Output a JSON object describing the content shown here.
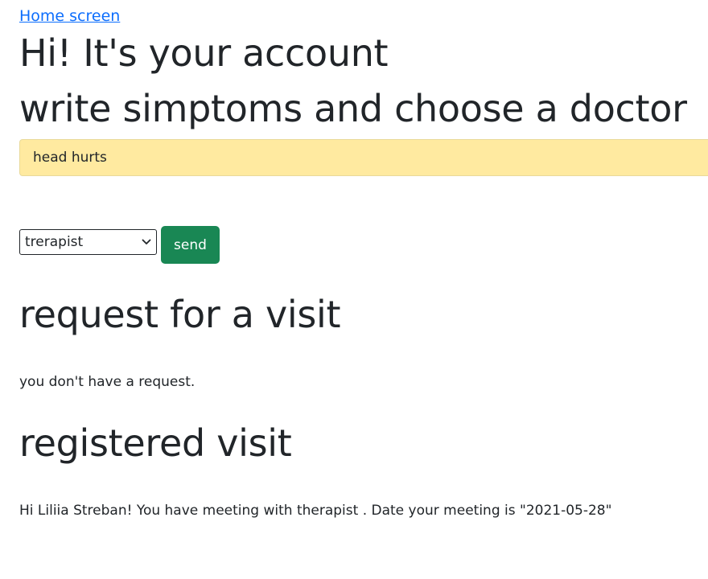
{
  "nav": {
    "home_link": "Home screen"
  },
  "header": {
    "title": "Hi! It's your account",
    "subtitle": "write simptoms and choose a doctor"
  },
  "form": {
    "symptoms_value": "head hurts",
    "doctor_select": {
      "selected": "trerapist"
    },
    "send_label": "send"
  },
  "request_section": {
    "heading": "request for a visit",
    "message": "you don't have a request."
  },
  "registered_section": {
    "heading": "registered visit",
    "message": "Hi Liliia Streban! You have meeting with therapist . Date your meeting is \"2021-05-28\""
  },
  "colors": {
    "link": "#0d6efd",
    "input_bg": "#ffeaa0",
    "send_button": "#198754",
    "text": "#212529"
  },
  "icons": {
    "select_arrow": "chevron-down-icon"
  }
}
